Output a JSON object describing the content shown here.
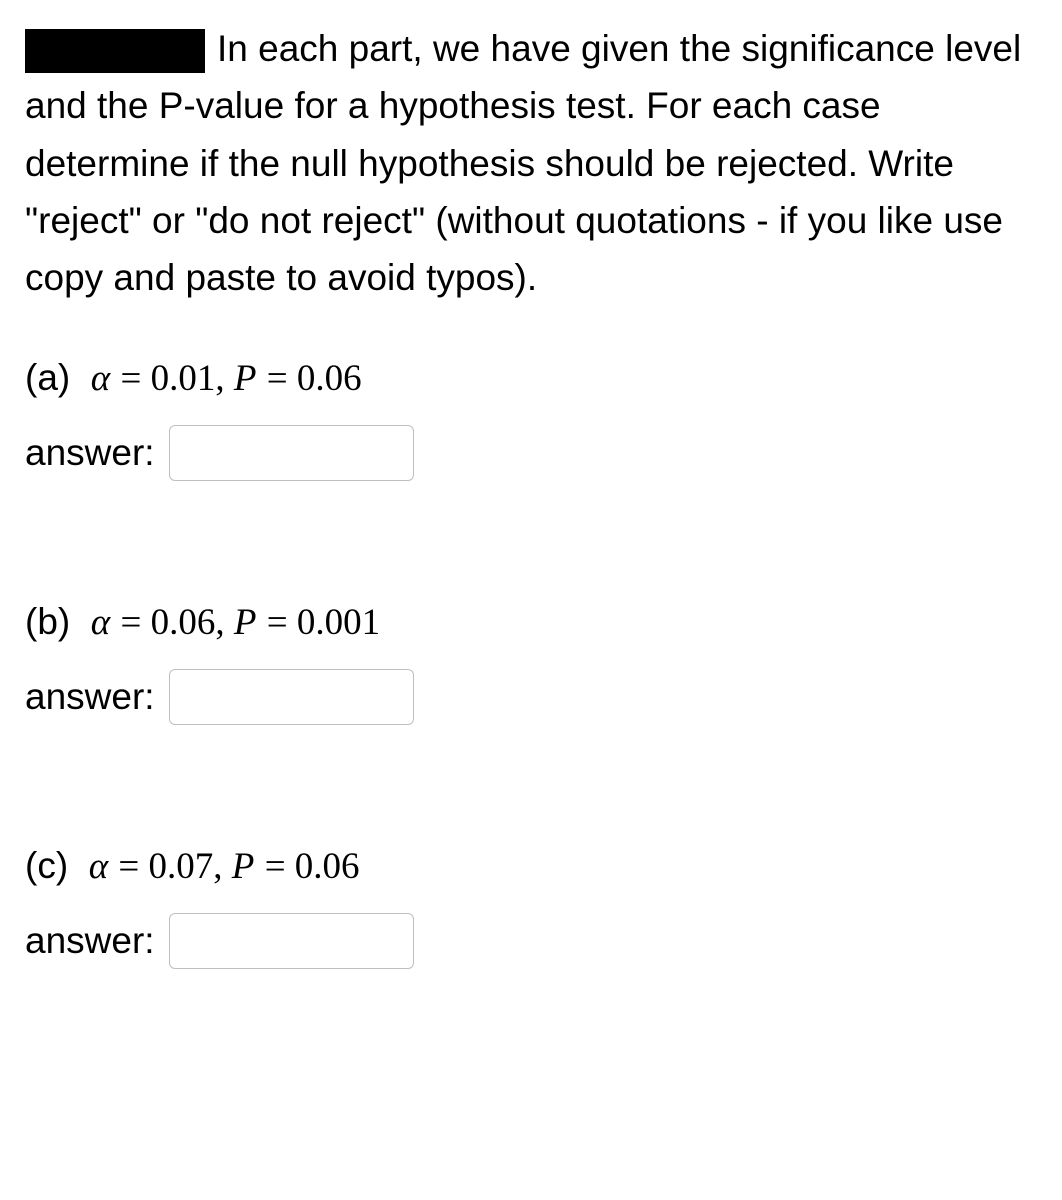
{
  "intro": {
    "text": "In each part, we have given the significance level and the P-value for a hypothesis test. For each case determine if the null hypothesis should be rejected. Write \"reject\" or \"do not reject\" (without quotations - if you like use copy and paste to avoid typos)."
  },
  "parts": {
    "a": {
      "label": "(a)",
      "alpha_eq": "α = 0.01",
      "p_eq": "P = 0.06",
      "answer_label": "answer:"
    },
    "b": {
      "label": "(b)",
      "alpha_eq": "α = 0.06",
      "p_eq": "P = 0.001",
      "answer_label": "answer:"
    },
    "c": {
      "label": "(c)",
      "alpha_eq": "α = 0.07",
      "p_eq": "P = 0.06",
      "answer_label": "answer:"
    }
  }
}
